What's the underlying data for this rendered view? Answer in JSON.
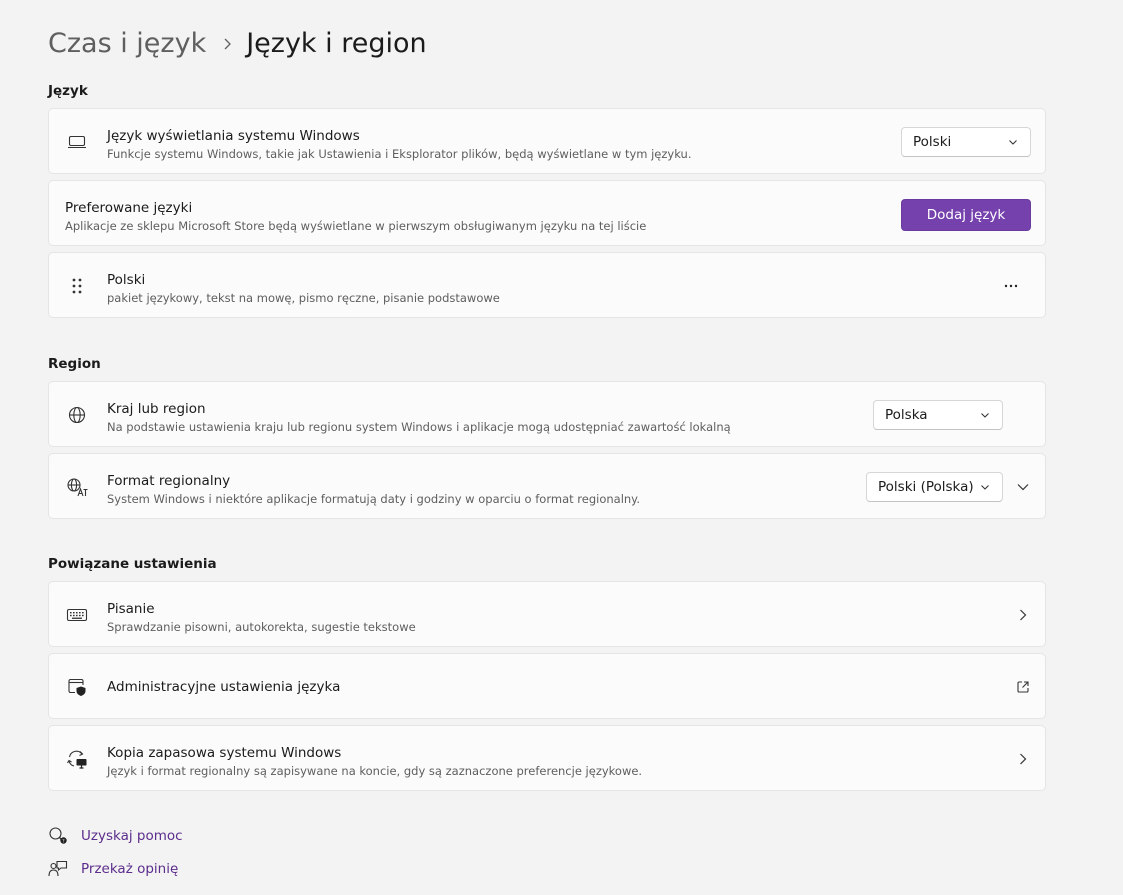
{
  "breadcrumb": {
    "parent": "Czas i język",
    "current": "Język i region"
  },
  "sections": {
    "language": "Język",
    "region": "Region",
    "related": "Powiązane ustawienia"
  },
  "language": {
    "display": {
      "title": "Język wyświetlania systemu Windows",
      "desc": "Funkcje systemu Windows, takie jak Ustawienia i Eksplorator plików, będą wyświetlane w tym języku.",
      "value": "Polski",
      "icon": "laptop-icon"
    },
    "preferred": {
      "title": "Preferowane języki",
      "desc": "Aplikacje ze sklepu Microsoft Store będą wyświetlane w pierwszym obsługiwanym języku na tej liście",
      "button": "Dodaj język"
    },
    "installed": {
      "title": "Polski",
      "desc": "pakiet językowy, tekst na mowę, pismo ręczne, pisanie podstawowe",
      "icon": "drag-handle-icon"
    }
  },
  "region": {
    "country": {
      "title": "Kraj lub region",
      "desc": "Na podstawie ustawienia kraju lub regionu system Windows i aplikacje mogą udostępniać zawartość lokalną",
      "value": "Polska",
      "icon": "globe-icon"
    },
    "format": {
      "title": "Format regionalny",
      "desc": "System Windows i niektóre aplikacje formatują daty i godziny w oparciu o format regionalny.",
      "value": "Polski (Polska)",
      "icon": "regional-format-icon"
    }
  },
  "related": {
    "typing": {
      "title": "Pisanie",
      "desc": "Sprawdzanie pisowni, autokorekta, sugestie tekstowe",
      "icon": "keyboard-icon"
    },
    "admin": {
      "title": "Administracyjne ustawienia języka",
      "icon": "admin-shield-icon"
    },
    "backup": {
      "title": "Kopia zapasowa systemu Windows",
      "desc": "Język i format regionalny są zapisywane na koncie, gdy są zaznaczone preferencje językowe.",
      "icon": "backup-sync-icon"
    }
  },
  "footer": {
    "help": "Uzyskaj pomoc",
    "feedback": "Przekaż opinię"
  },
  "colors": {
    "accent": "#7541ad",
    "link": "#5b2d8c",
    "background": "#f3f3f3",
    "card": "#fbfbfb"
  }
}
